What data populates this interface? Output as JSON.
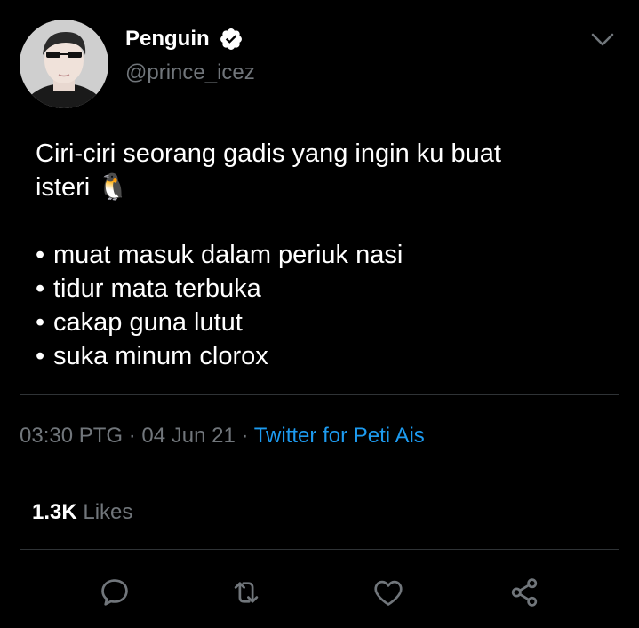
{
  "tweet": {
    "author": {
      "display_name": "Penguin",
      "handle": "@prince_icez",
      "verified_icon": "verified-badge-icon"
    },
    "text_lines": [
      "Ciri-ciri seorang gadis yang ingin ku buat",
      "isteri 🐧"
    ],
    "bullets": [
      "muat masuk dalam periuk nasi",
      "tidur mata terbuka",
      "cakap guna lutut",
      "suka minum clorox"
    ],
    "bullet_char": "•",
    "meta": {
      "time": "03:30 PTG",
      "separator": " · ",
      "date": "04 Jun 21",
      "source": "Twitter for Peti Ais"
    },
    "likes": {
      "count": "1.3K",
      "label": "Likes"
    }
  },
  "actions": {
    "reply_icon": "reply-icon",
    "retweet_icon": "retweet-icon",
    "like_icon": "heart-icon",
    "share_icon": "share-icon"
  },
  "colors": {
    "background": "#000000",
    "text": "#ffffff",
    "muted": "#71767b",
    "link": "#1d9bf0",
    "divider": "#2f3336"
  }
}
